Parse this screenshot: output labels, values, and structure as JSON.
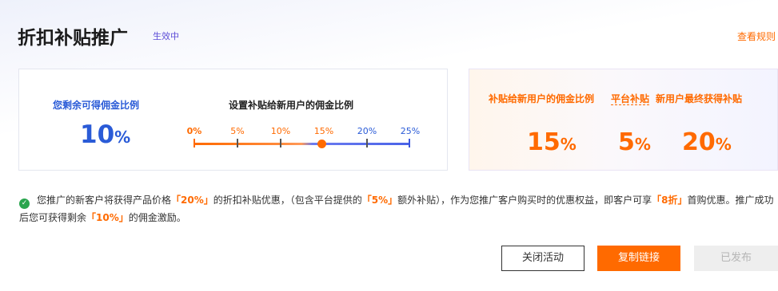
{
  "header": {
    "title": "折扣补贴推广",
    "status": "生效中",
    "rules_link": "查看规则"
  },
  "left_card": {
    "remaining_label": "您剩余可得佣金比例",
    "remaining_value": "10",
    "remaining_unit": "%",
    "slider_title": "设置补贴给新用户的佣金比例",
    "slider_ticks": [
      "0%",
      "5%",
      "10%",
      "15%",
      "20%",
      "25%"
    ],
    "slider_value_percent": 15,
    "slider_max_percent": 25
  },
  "right_card": {
    "new_user_subsidy_label": "补贴给新用户的佣金比例",
    "new_user_subsidy_value": "15",
    "platform_subsidy_label": "平台补贴",
    "platform_subsidy_value": "5",
    "final_label": "新用户最终获得补贴",
    "final_value": "20",
    "unit": "%"
  },
  "notice": {
    "t1": "您推广的新客户将获得产品价格",
    "h1": "「20%」",
    "t2": "的折扣补贴优惠，（包含平台提供的",
    "h2": "「5%」",
    "t3": "额外补贴），作为您推广客户购买时的优惠权益，即客户可享",
    "h3": "「8折」",
    "t4": "首购优惠。推广成功后您可获得剩余",
    "h4": "「10%」",
    "t5": "的佣金激励。"
  },
  "buttons": {
    "close": "关闭活动",
    "copy": "复制链接",
    "published": "已发布"
  },
  "colors": {
    "accent_orange": "#ff6a00",
    "accent_blue": "#2a5bd7",
    "success_green": "#2aa54e"
  }
}
